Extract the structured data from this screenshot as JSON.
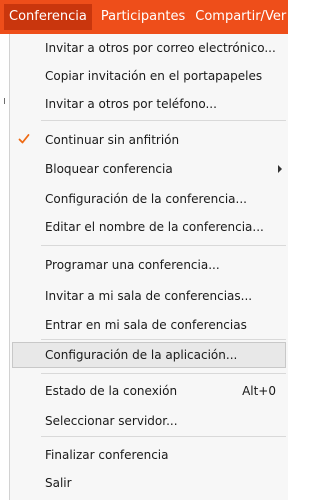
{
  "menubar": {
    "items": [
      {
        "label": "Conferencia"
      },
      {
        "label": "Participantes"
      },
      {
        "label": "Compartir/Ver"
      }
    ]
  },
  "menu": {
    "items": [
      {
        "label": "Invitar a otros por correo electrónico..."
      },
      {
        "label": "Copiar invitación en el portapapeles"
      },
      {
        "label": "Invitar a otros por teléfono..."
      },
      {
        "label": "Continuar sin anfitrión",
        "checked": true
      },
      {
        "label": "Bloquear conferencia",
        "has_submenu": true
      },
      {
        "label": "Configuración de la conferencia..."
      },
      {
        "label": "Editar el nombre de la conferencia..."
      },
      {
        "label": "Programar una conferencia..."
      },
      {
        "label": "Invitar a mi sala de conferencias..."
      },
      {
        "label": "Entrar en mi sala de conferencias"
      },
      {
        "label": "Configuración de la aplicación...",
        "hovered": true
      },
      {
        "label": "Estado de la conexión",
        "shortcut": "Alt+0"
      },
      {
        "label": "Seleccionar servidor..."
      },
      {
        "label": "Finalizar conferencia"
      },
      {
        "label": "Salir"
      }
    ]
  },
  "colors": {
    "menubar_bg": "#ee4e1a",
    "menubar_active_bg": "#c9360d",
    "checkmark": "#ee6a14",
    "dropdown_bg": "#f7f7f7"
  },
  "icons": {
    "checkmark": "check-icon",
    "submenu": "submenu-arrow-icon"
  }
}
